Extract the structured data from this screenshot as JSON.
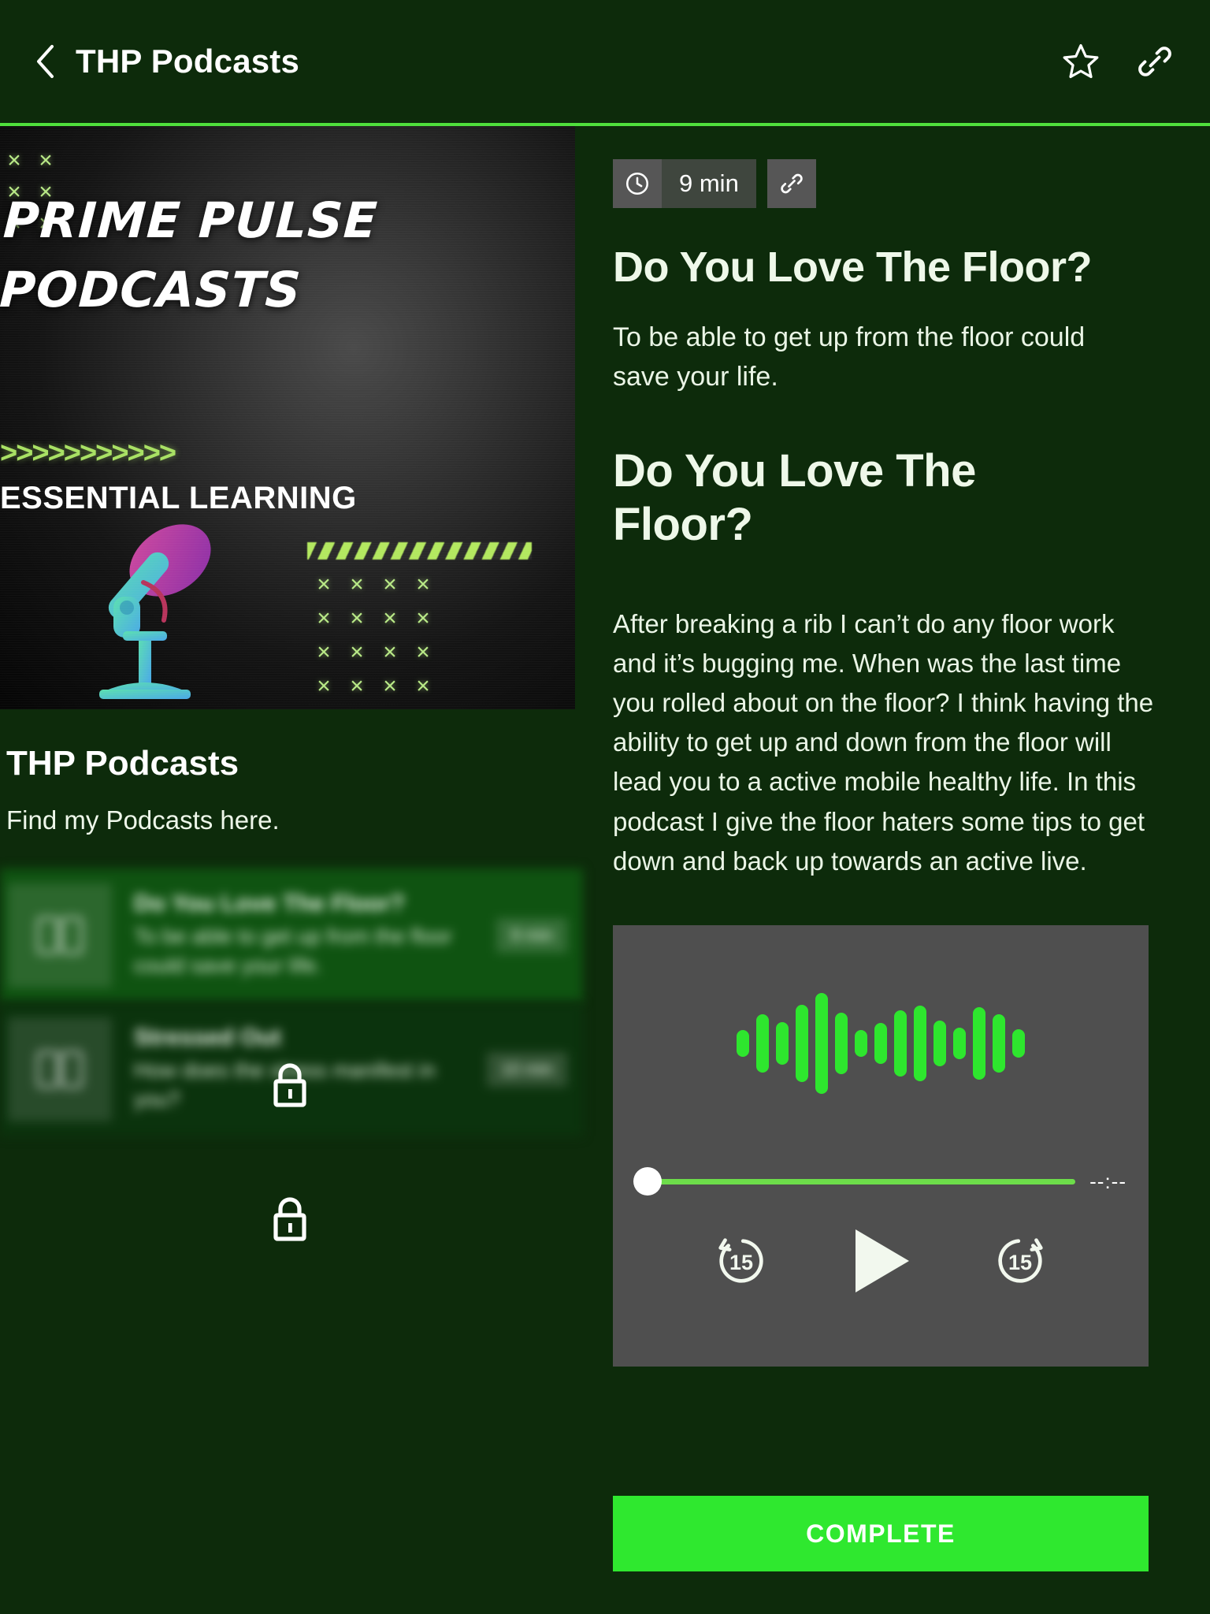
{
  "header": {
    "title": "THP Podcasts",
    "back_icon": "chevron-left-icon",
    "favorite_icon": "star-icon",
    "share_icon": "link-icon",
    "accent": "#4fe03c"
  },
  "cover": {
    "title_line1": "PRIME PULSE",
    "title_line2": "PODCASTS",
    "arrows": ">>>>>>>>>>>",
    "subtitle": "ESSENTIAL LEARNING",
    "x_mark": "×"
  },
  "left": {
    "collection_title": "THP Podcasts",
    "collection_subtitle": "Find my Podcasts here.",
    "items": [
      {
        "title": "Do You Love The Floor?",
        "description": "To be able to get up from the floor could save your life.",
        "duration": "9 min",
        "locked": true,
        "lock_icon": "lock-icon",
        "thumb_icon": "book-icon"
      },
      {
        "title": "Stressed Out",
        "description": "How does the stress manifest in you?",
        "duration": "10 min",
        "locked": true,
        "lock_icon": "lock-icon",
        "thumb_icon": "book-icon"
      }
    ]
  },
  "detail": {
    "duration": "9 min",
    "clock_icon": "clock-icon",
    "link_icon": "link-icon",
    "title": "Do You Love The Floor?",
    "lede": "To be able to get up from the floor could save your life.",
    "heading": "Do You Love The Floor?",
    "body": "After breaking a rib I can’t do any floor work and it’s bugging me. When was the last time you rolled about on the floor? I think having the ability to get up and down from the floor will lead you to a active mobile healthy life. In this podcast I give the floor haters some tips to get down and back up towards an active live."
  },
  "player": {
    "time_display": "--:--",
    "rewind_label": "15",
    "forward_label": "15",
    "play_icon": "play-icon",
    "rewind_icon": "rewind-15-icon",
    "forward_icon": "forward-15-icon",
    "progress_percent": 0,
    "waveform_heights": [
      34,
      74,
      54,
      98,
      128,
      78,
      34,
      52,
      84,
      96,
      58,
      40,
      92,
      74,
      36
    ],
    "waveform_color": "#2ee62e",
    "track_color": "#6ddd4a",
    "panel_color": "#4f4f4f"
  },
  "footer": {
    "complete_label": "COMPLETE",
    "complete_color": "#2fe82f"
  }
}
